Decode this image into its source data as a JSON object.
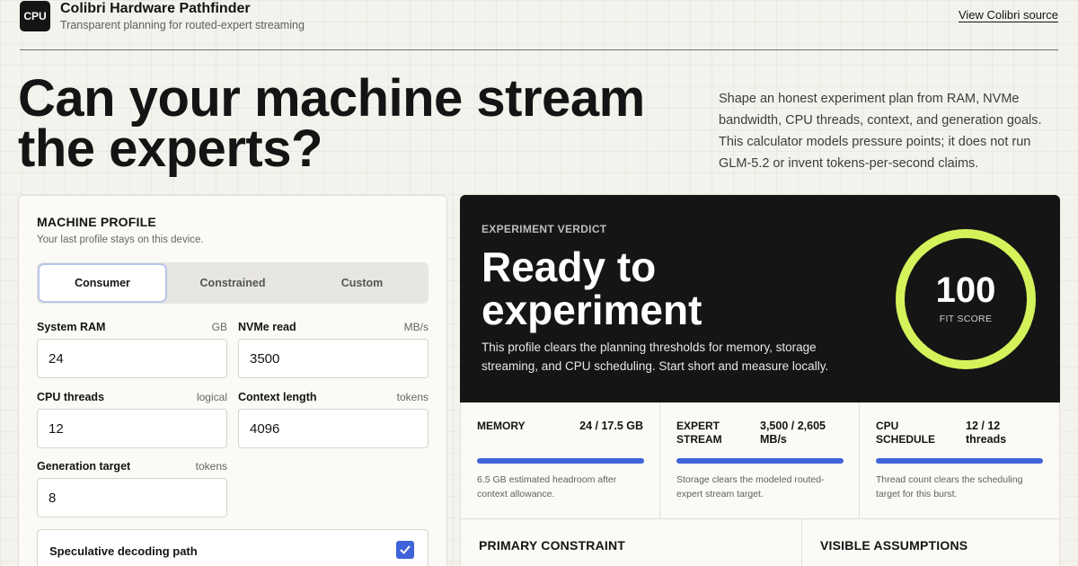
{
  "header": {
    "logo_text": "CPU",
    "title": "Colibri Hardware Pathfinder",
    "subtitle": "Transparent planning for routed-expert streaming",
    "source_link": "View Colibri source"
  },
  "hero": {
    "title_line1": "Can your machine stream",
    "title_line2": "the experts?",
    "description": "Shape an honest experiment plan from RAM, NVMe bandwidth, CPU threads, context, and generation goals. This calculator models pressure points; it does not run GLM-5.2 or invent tokens-per-second claims."
  },
  "profile": {
    "title": "MACHINE PROFILE",
    "subtitle": "Your last profile stays on this device.",
    "presets": [
      {
        "label": "Consumer",
        "active": true
      },
      {
        "label": "Constrained",
        "active": false
      },
      {
        "label": "Custom",
        "active": false
      }
    ],
    "fields": {
      "ram": {
        "label": "System RAM",
        "unit": "GB",
        "value": "24"
      },
      "nvme": {
        "label": "NVMe read",
        "unit": "MB/s",
        "value": "3500"
      },
      "threads": {
        "label": "CPU threads",
        "unit": "logical",
        "value": "12"
      },
      "context": {
        "label": "Context length",
        "unit": "tokens",
        "value": "4096"
      },
      "generation": {
        "label": "Generation target",
        "unit": "tokens",
        "value": "8"
      }
    },
    "speculative": {
      "label": "Speculative decoding path",
      "checked": true
    }
  },
  "verdict": {
    "kicker": "EXPERIMENT VERDICT",
    "title_line1": "Ready to",
    "title_line2": "experiment",
    "description": "This profile clears the planning thresholds for memory, storage streaming, and CPU scheduling. Start short and measure locally.",
    "score": "100",
    "score_label": "FIT SCORE",
    "score_fraction": 1.0,
    "ring_color": "#d4f25a"
  },
  "metrics": [
    {
      "name_l1": "MEMORY",
      "name_l2": "",
      "value_l1": "24 / 17.5 GB",
      "value_l2": "",
      "note_l1": "6.5 GB estimated headroom after",
      "note_l2": "context allowance.",
      "fill": 1.0
    },
    {
      "name_l1": "EXPERT",
      "name_l2": "STREAM",
      "value_l1": "3,500 / 2,605",
      "value_l2": "MB/s",
      "note_l1": "Storage clears the modeled routed-",
      "note_l2": "expert stream target.",
      "fill": 1.0
    },
    {
      "name_l1": "CPU",
      "name_l2": "SCHEDULE",
      "value_l1": "12 / 12",
      "value_l2": "threads",
      "note_l1": "Thread count clears the scheduling",
      "note_l2": "target for this burst.",
      "fill": 1.0
    }
  ],
  "sections": {
    "primary_constraint": "PRIMARY CONSTRAINT",
    "visible_assumptions": "VISIBLE ASSUMPTIONS"
  },
  "colors": {
    "accent": "#3f63d9",
    "dark": "#151515",
    "ring": "#d4f25a"
  }
}
